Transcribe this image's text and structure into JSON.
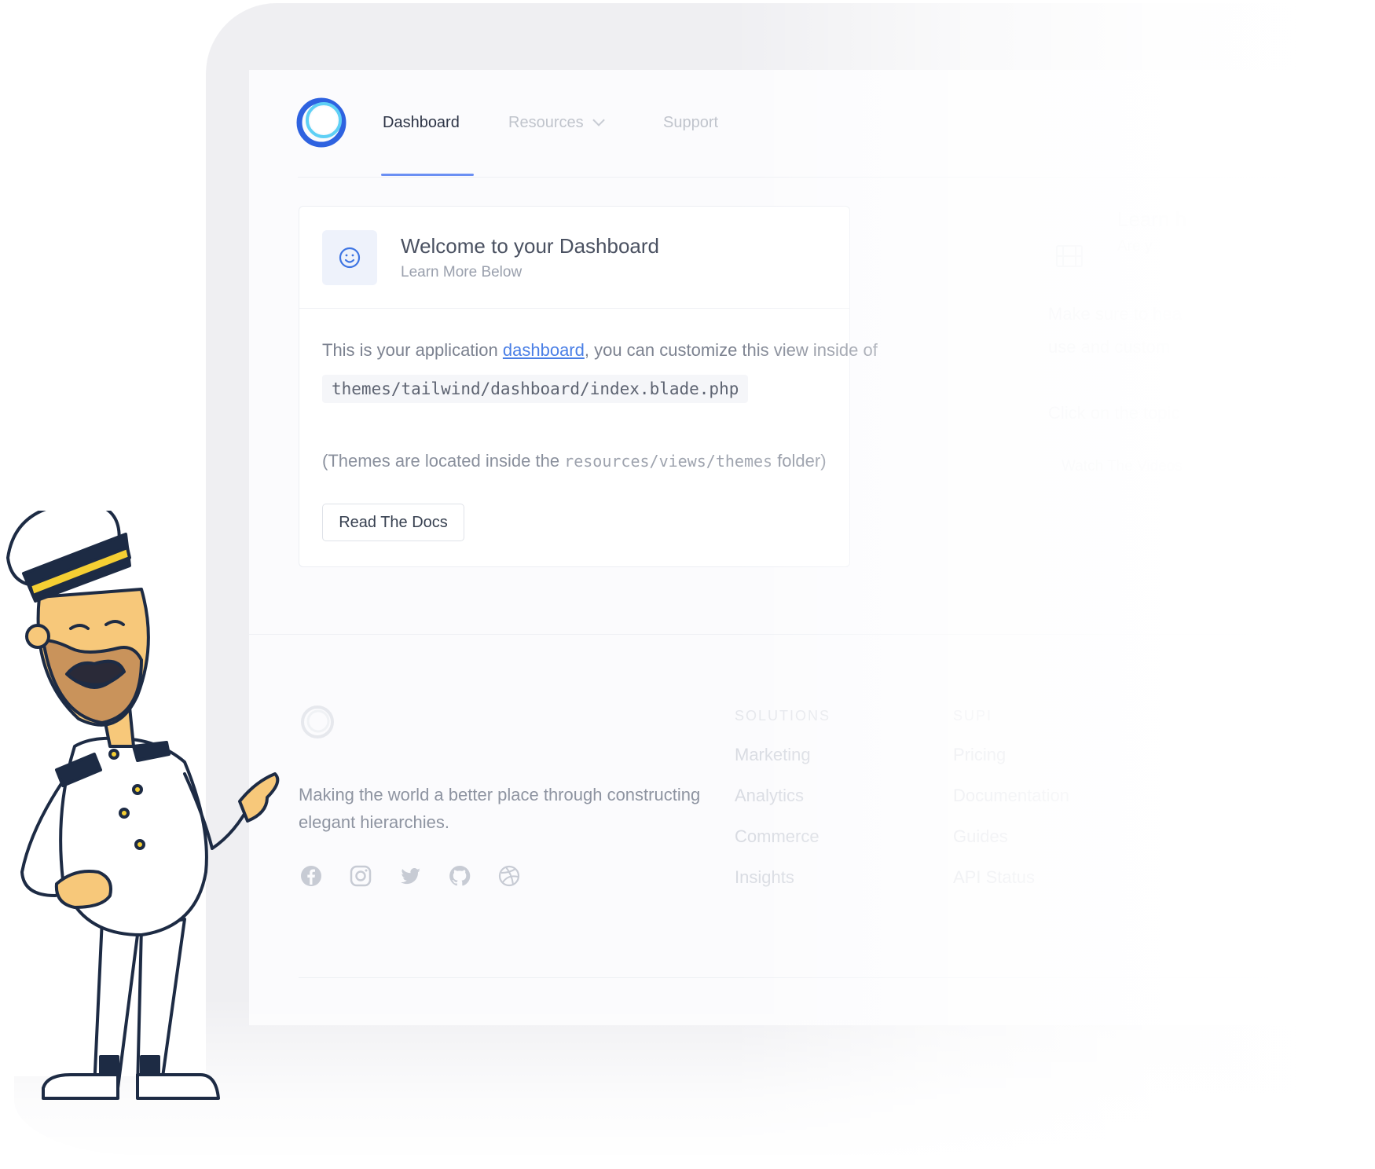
{
  "nav": {
    "items": [
      {
        "label": "Dashboard",
        "active": true
      },
      {
        "label": "Resources",
        "active": false
      },
      {
        "label": "Support",
        "active": false
      }
    ]
  },
  "card": {
    "title": "Welcome to your Dashboard",
    "subtitle": "Learn More Below",
    "body_prefix": "This is your application ",
    "body_link": "dashboard",
    "body_suffix": ", you can customize this view inside of",
    "code_path": "themes/tailwind/dashboard/index.blade.php",
    "note_prefix": "(Themes are located inside the ",
    "note_code": "resources/views/themes",
    "note_suffix": " folder)",
    "button_label": "Read The Docs"
  },
  "card2": {
    "title": "Learn h",
    "subtitle": "Are y",
    "line1": "Make sure to hea",
    "line2": "use and custom",
    "line3": "Click on the topic",
    "button_label": "Watch The Videos"
  },
  "footer": {
    "tagline": "Making the world a better place through constructing elegant hierarchies.",
    "social_icons": [
      "facebook-icon",
      "instagram-icon",
      "twitter-icon",
      "github-icon",
      "dribbble-icon"
    ],
    "columns": [
      {
        "heading": "SOLUTIONS",
        "links": [
          "Marketing",
          "Analytics",
          "Commerce",
          "Insights"
        ]
      },
      {
        "heading": "SUPI",
        "links": [
          "Pricing",
          "Documentation",
          "Guides",
          "API Status"
        ]
      }
    ]
  },
  "colors": {
    "accent": "#4a7fe6",
    "text_dark": "#2d3446",
    "muted": "#9aa0ad"
  }
}
